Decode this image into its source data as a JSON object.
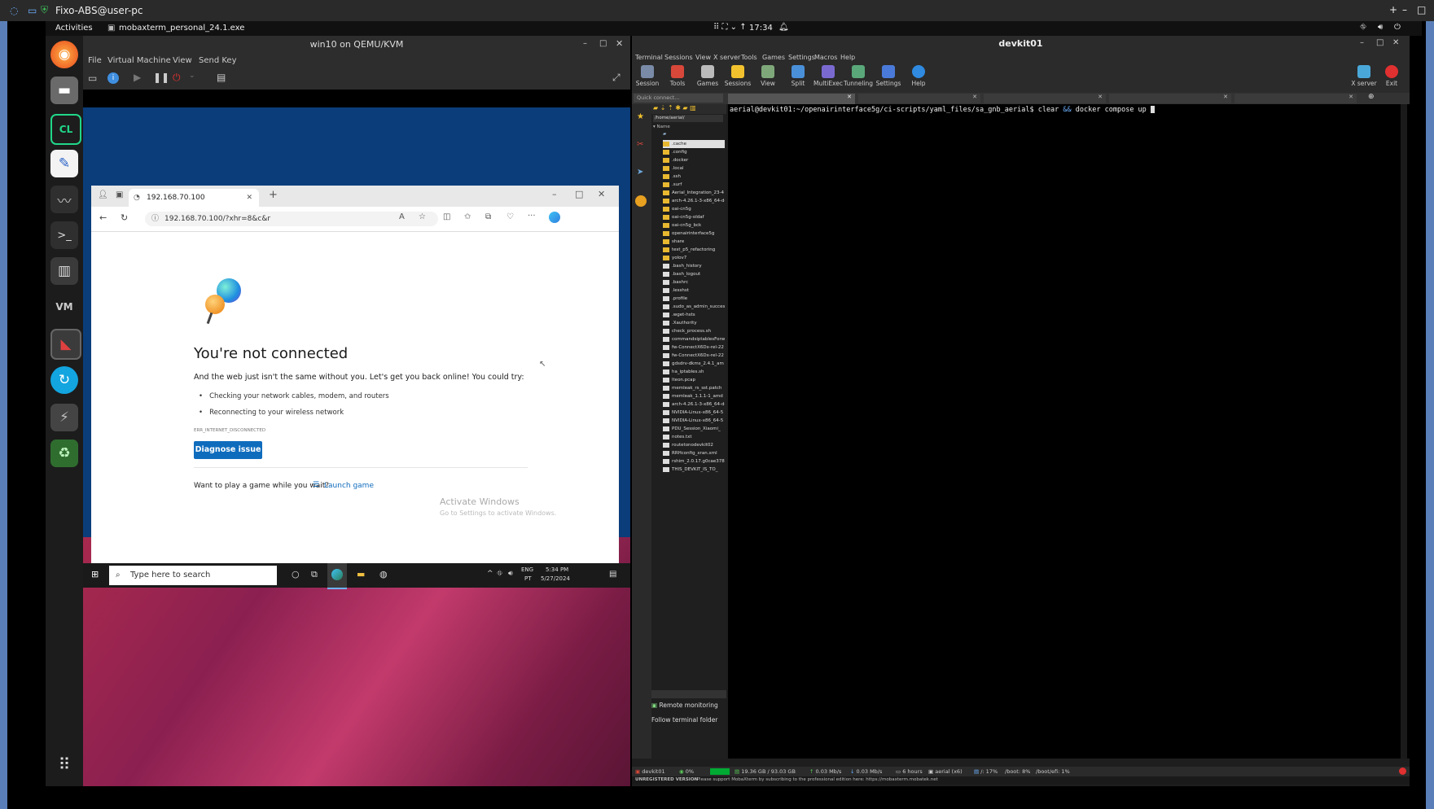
{
  "outer": {
    "title": "Fixo-ABS@user-pc",
    "controls": [
      "+",
      "–",
      "□"
    ]
  },
  "topbar": {
    "activities": "Activities",
    "app_title": "mobaxterm_personal_24.1.exe",
    "clock": "17:34"
  },
  "dock": {
    "items": [
      "firefox-icon",
      "files-icon",
      "clion-icon",
      "text-editor-icon",
      "system-monitor-icon",
      "terminal-icon",
      "virt-manager-icon",
      "vim-icon",
      "mobaxterm-icon",
      "software-updater-icon",
      "usb-icon",
      "trash-icon",
      "apps-grid-icon"
    ]
  },
  "qemu": {
    "title": "win10 on QEMU/KVM",
    "menu": [
      "File",
      "Virtual Machine",
      "View",
      "Send Key"
    ]
  },
  "edge": {
    "tab_title": "192.168.70.100",
    "address": "192.168.70.100/?xhr=8&c&r",
    "heading": "You're not connected",
    "subtitle": "And the web just isn't the same without you. Let's get you back online! You could try:",
    "tips": [
      "Checking your network cables, modem, and routers",
      "Reconnecting to your wireless network"
    ],
    "error_code": "ERR_INTERNET_DISCONNECTED",
    "diagnose_label": "Diagnose issue",
    "game_prompt": "Want to play a game while you wait?",
    "launch_game": "Launch game",
    "activate_title": "Activate Windows",
    "activate_sub": "Go to Settings to activate Windows."
  },
  "win_taskbar": {
    "search_placeholder": "Type here to search",
    "lang": "ENG",
    "region": "PT",
    "time": "5:34 PM",
    "date": "5/27/2024"
  },
  "moba": {
    "title": "devkit01",
    "menu": [
      "Terminal",
      "Sessions",
      "View",
      "X server",
      "Tools",
      "Games",
      "Settings",
      "Macros",
      "Help"
    ],
    "toolbar": [
      "Session",
      "Tools",
      "Games",
      "Sessions",
      "View",
      "Split",
      "MultiExec",
      "Tunneling",
      "Settings",
      "Help"
    ],
    "toolbar_right": [
      "X server",
      "Exit"
    ],
    "quick_connect": "Quick connect...",
    "sftp_path": "/home/aerial/",
    "sftp_header": "Name",
    "files": [
      ".cache",
      ".config",
      ".docker",
      ".local",
      ".ssh",
      ".surf",
      "Aerial_Integration_23-4",
      "arch-4.26.1-3-x86_64-de",
      "oai-cn5g",
      "oai-cn5g-oldaf",
      "oai-cn5g_bck",
      "openairinterface5g",
      "share",
      "test_p5_refactoring",
      "yolov7",
      ".bash_history",
      ".bash_logout",
      ".bashrc",
      ".lesshst",
      ".profile",
      ".sudo_as_admin_succes",
      ".wget-hsts",
      ".Xauthority",
      "check_process.sh",
      "commandsiptablesForw",
      "fw-ConnectX6Dx-rel-22",
      "fw-ConnectX6Dx-rel-22",
      "gdsdrv-dkms_2.4.1_am",
      "ha_iptables.sh",
      "lteon.pcap",
      "memleak_rs_sst.patch",
      "memleak_1.1.1-1_amd",
      "arch-4.26.1-3-x86_64-de",
      "NVIDIA-Linux-x86_64-5",
      "NVIDIA-Linux-x86_64-5",
      "PDU_Session_Xiaomi_",
      "notes.txt",
      "routetonodevkit02",
      "RRHconfig_xran.xml",
      "rshim_2.0.17.g0cae378",
      "THIS_DEVKIT_IS_TO_"
    ],
    "remote_monitoring": "Remote monitoring",
    "follow_folder": "Follow terminal folder",
    "prompt": "aerial@devkit01:~/openairinterface5g/ci-scripts/yaml_files/sa_gnb_aerial$",
    "cmd_a": "clear",
    "cmd_op": "&&",
    "cmd_b": "docker compose up",
    "status": {
      "host": "devkit01",
      "cpu": "0%",
      "disk": "19.36 GB / 93.03 GB",
      "up": "0.03 Mb/s",
      "down": "0.03 Mb/s",
      "uptime": "6 hours",
      "user": "aerial (x6)",
      "root": "/: 17%",
      "boot": "/boot: 8%",
      "efi": "/boot/efi: 1%"
    },
    "unregistered": "UNREGISTERED VERSION",
    "unregistered_msg": "-  Please support MobaXterm by subscribing to the professional edition here:  https://mobaxterm.mobatek.net"
  }
}
